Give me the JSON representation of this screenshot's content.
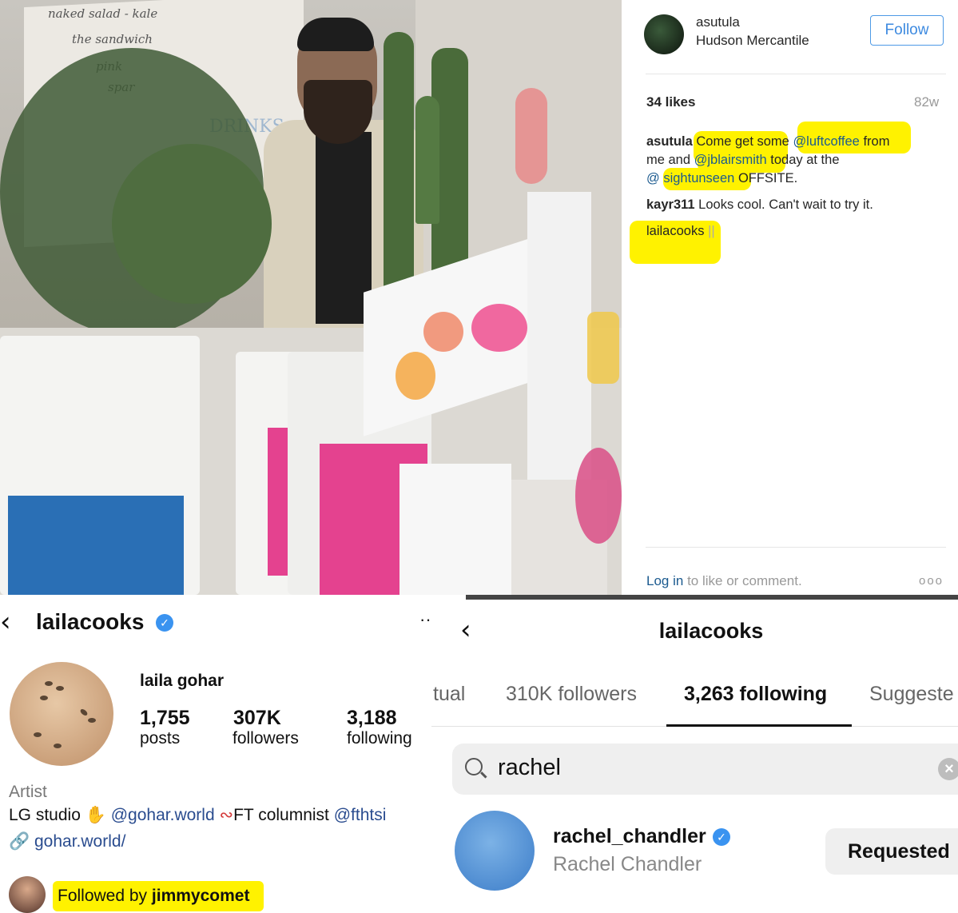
{
  "post": {
    "menu_board": [
      "naked salad - kale",
      "the sandwich",
      "pink",
      "spar",
      "DRINKS"
    ],
    "username": "asutula",
    "location": "Hudson Mercantile",
    "follow_label": "Follow",
    "likes": "34 likes",
    "age": "82w",
    "caption": {
      "author": "asutula",
      "t1": "Come get some",
      "m1": "@luftcoffee",
      "t2": "from",
      "t3": "me and",
      "m2": "@jblairsmith",
      "t4": "today at the",
      "m3": "@",
      "m4": "sightunseen",
      "t5": "OFFSITE."
    },
    "comment": {
      "user": "kayr311",
      "text": "Looks cool. Can't wait to try it."
    },
    "reply_user": "lailacooks",
    "login_link": "Log in",
    "login_rest": "to like or comment.",
    "more": "ooo"
  },
  "profile": {
    "handle": "lailacooks",
    "name": "laila gohar",
    "stats": [
      {
        "num": "1,755",
        "label": "posts"
      },
      {
        "num": "307K",
        "label": "followers"
      },
      {
        "num": "3,188",
        "label": "following"
      }
    ],
    "category": "Artist",
    "bio_1": "LG studio",
    "bio_link_1": "@gohar.world",
    "bio_2": "FT columnist",
    "bio_link_2": "@fthtsi",
    "website": "gohar.world/",
    "followed_by_prefix": "Followed by",
    "followed_by_user": "jimmycomet"
  },
  "following": {
    "title": "lailacooks",
    "tabs": [
      "tual",
      "310K followers",
      "3,263 following",
      "Suggeste"
    ],
    "search_value": "rachel",
    "result_username": "rachel_chandler",
    "result_name": "Rachel Chandler",
    "result_button": "Requested"
  },
  "colors": {
    "highlight": "#fff200",
    "verified": "#3a93f0",
    "follow_blue": "#3d8ae0",
    "link": "#2a4c8f"
  }
}
